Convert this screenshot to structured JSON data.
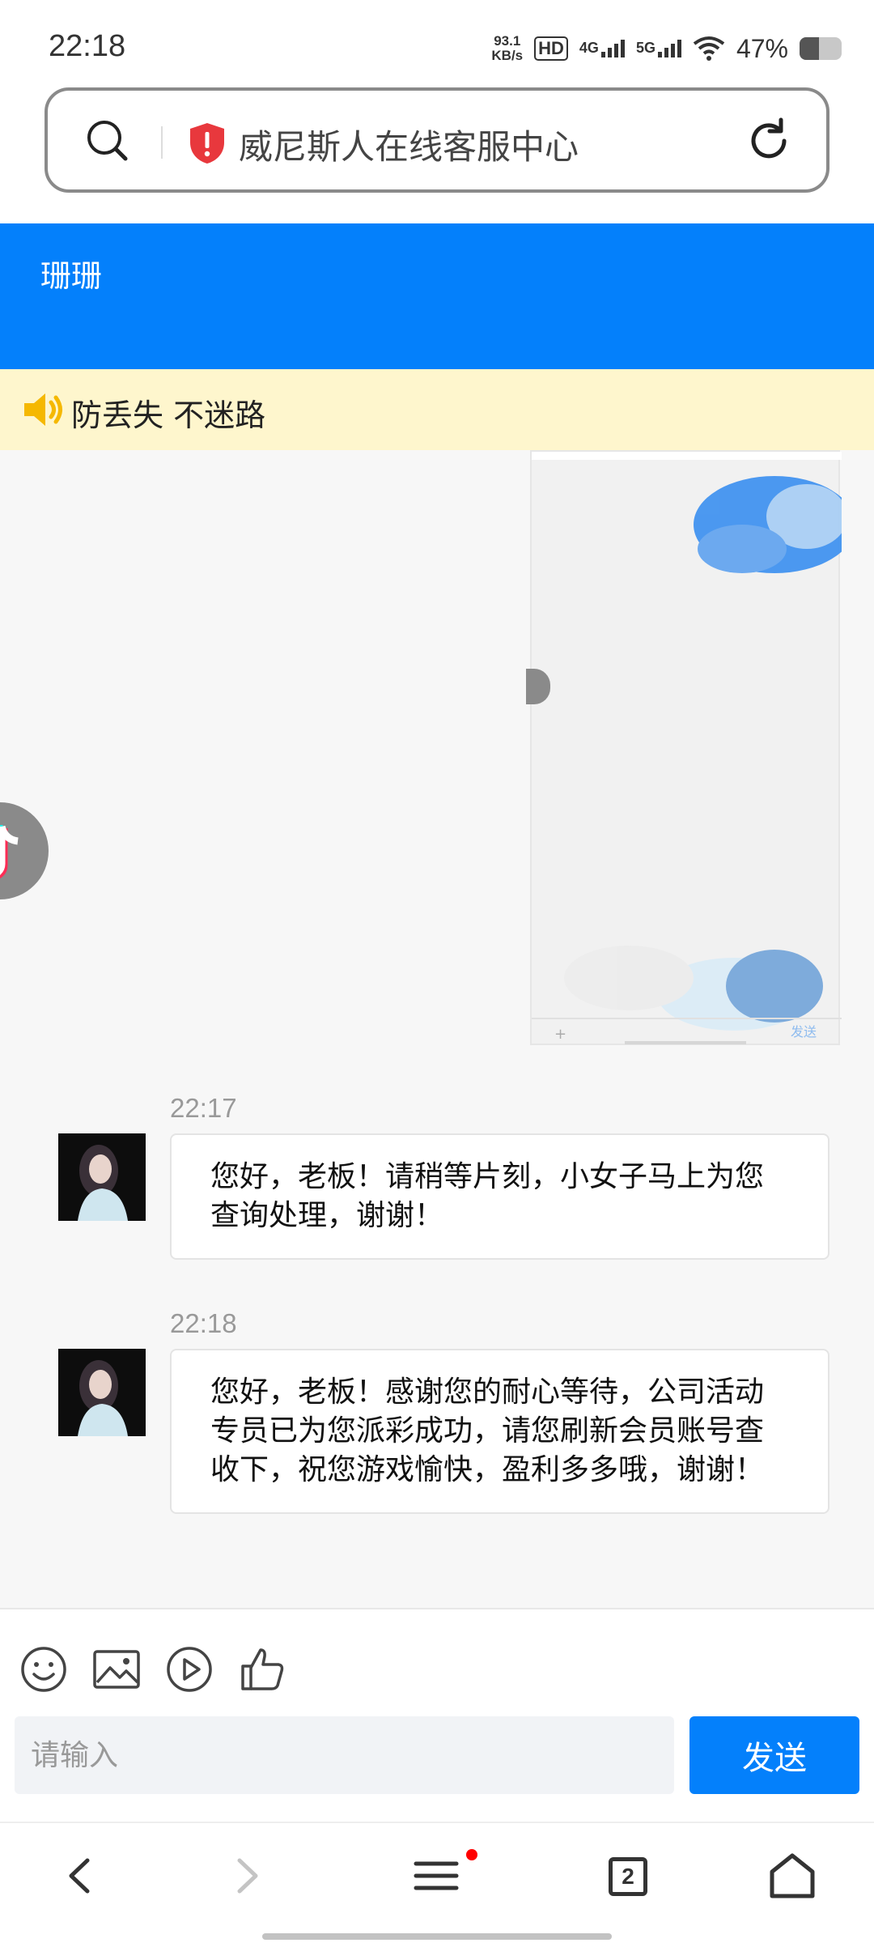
{
  "status_bar": {
    "time": "22:18",
    "net_speed_value": "93.1",
    "net_speed_unit": "KB/s",
    "hd_label": "HD",
    "network_1": "4G",
    "network_2": "5G",
    "battery_percent": "47%",
    "battery_level": 0.47
  },
  "browser": {
    "page_title": "威尼斯人在线客服中心",
    "icons": [
      "search-icon",
      "shield-alert-icon",
      "reload-icon"
    ]
  },
  "header": {
    "agent_name": "珊珊"
  },
  "notice": {
    "text": "防丢失 不迷路"
  },
  "messages": [
    {
      "time": "22:17",
      "text": "您好，老板！请稍等片刻，小女子马上为您查询处理，谢谢！"
    },
    {
      "time": "22:18",
      "text": "您好，老板！感谢您的耐心等待，公司活动专员已为您派彩成功，请您刷新会员账号查收下，祝您游戏愉快，盈利多多哦，谢谢！"
    }
  ],
  "composer": {
    "placeholder": "请输入",
    "send_label": "发送",
    "tools": [
      "emoji-icon",
      "image-icon",
      "video-icon",
      "thumbs-up-icon"
    ]
  },
  "nav_bar": {
    "tab_count": "2",
    "icons": [
      "back-icon",
      "forward-icon",
      "menu-icon",
      "tabs-icon",
      "home-icon"
    ]
  },
  "colors": {
    "accent": "#0480fb",
    "notice_bg": "#fef6cd",
    "shield": "#e8383d"
  }
}
